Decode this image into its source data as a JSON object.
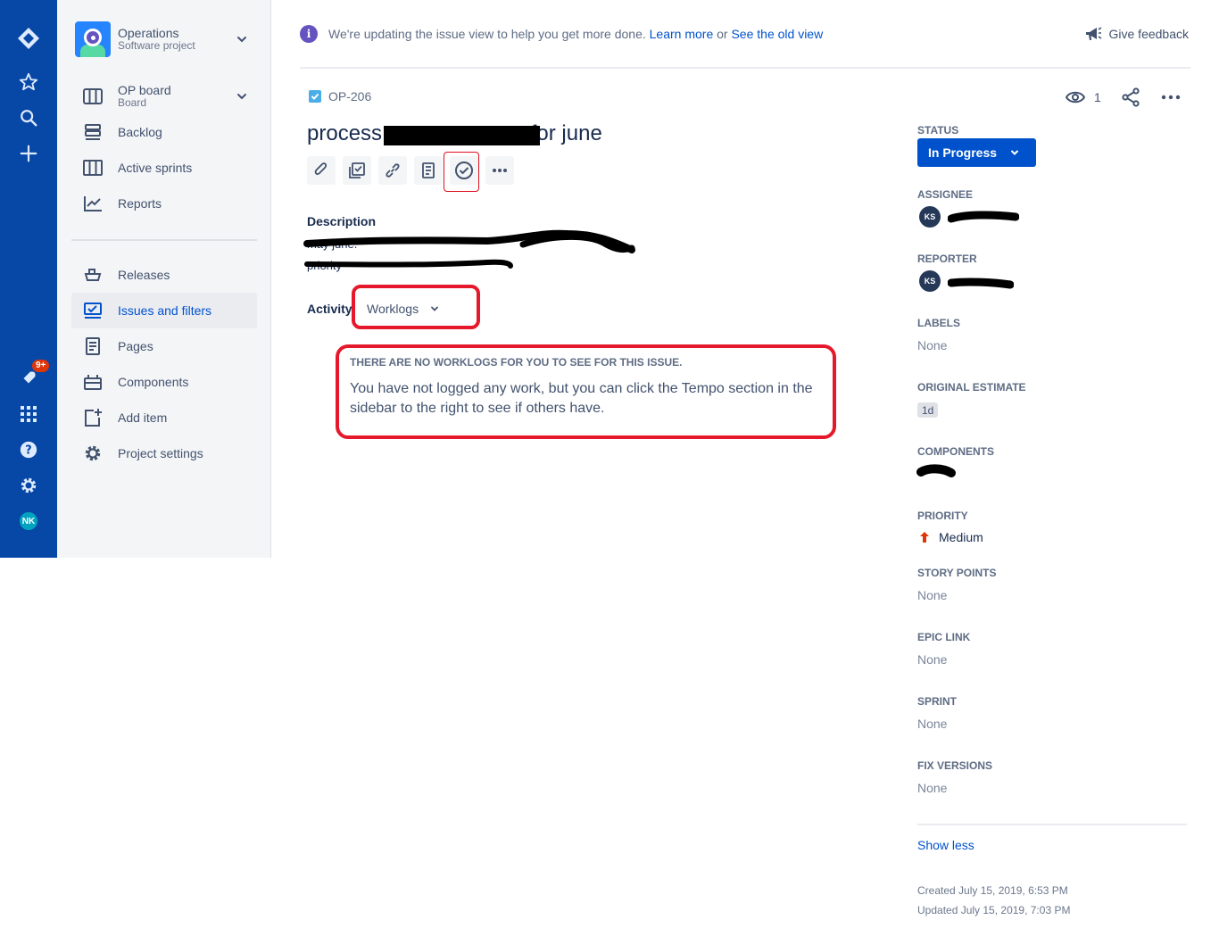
{
  "global_nav": {
    "notification_badge": "9+",
    "avatar_initials": "NK",
    "bg_color": "#0747a6"
  },
  "sidebar": {
    "project_name": "Operations",
    "project_type": "Software project",
    "board_name": "OP board",
    "board_type": "Board",
    "items": [
      {
        "label": "Backlog"
      },
      {
        "label": "Active sprints"
      },
      {
        "label": "Reports"
      },
      {
        "label": "Releases"
      },
      {
        "label": "Issues and filters"
      },
      {
        "label": "Pages"
      },
      {
        "label": "Components"
      },
      {
        "label": "Add item"
      },
      {
        "label": "Project settings"
      }
    ]
  },
  "banner": {
    "text": "We're updating the issue view to help you get more done.",
    "learn_more": "Learn more",
    "or": "or",
    "old_view": "See the old view",
    "feedback": "Give feedback"
  },
  "issue": {
    "key": "OP-206",
    "title": "process                         for june",
    "watchers": "1",
    "description_label": "Description",
    "desc_line1": "                                                                  may june.",
    "desc_line2": "                                 priority",
    "activity_label": "Activity",
    "activity_filter": "Worklogs",
    "worklog_title": "THERE ARE NO WORKLOGS FOR YOU TO SEE FOR THIS ISSUE.",
    "worklog_body": "You have not logged any work, but you can click the Tempo section in the sidebar to the right to see if others have."
  },
  "fields": {
    "status_label": "STATUS",
    "status_value": "In Progress",
    "assignee_label": "ASSIGNEE",
    "assignee_initials": "KS",
    "reporter_label": "REPORTER",
    "reporter_initials": "KS",
    "labels_label": "LABELS",
    "labels_value": "None",
    "estimate_label": "ORIGINAL ESTIMATE",
    "estimate_value": "1d",
    "components_label": "COMPONENTS",
    "priority_label": "PRIORITY",
    "priority_value": "Medium",
    "story_points_label": "STORY POINTS",
    "story_points_value": "None",
    "epic_link_label": "EPIC LINK",
    "epic_link_value": "None",
    "sprint_label": "SPRINT",
    "sprint_value": "None",
    "fix_versions_label": "FIX VERSIONS",
    "fix_versions_value": "None",
    "show_less": "Show less",
    "created": "Created July 15, 2019, 6:53 PM",
    "updated": "Updated July 15, 2019, 7:03 PM"
  },
  "colors": {
    "accent": "#0052cc",
    "annotation_red": "#e5192b",
    "priority_medium": "#de350b"
  },
  "icons": [
    "jira-logo-icon",
    "star-icon",
    "search-icon",
    "plus-icon",
    "rocket-icon",
    "app-switcher-icon",
    "help-icon",
    "settings-icon",
    "board-icon",
    "backlog-icon",
    "sprints-icon",
    "reports-icon",
    "releases-icon",
    "issues-icon",
    "pages-icon",
    "components-icon",
    "add-item-icon",
    "project-settings-icon",
    "info-icon",
    "megaphone-icon",
    "eye-icon",
    "share-icon",
    "more-icon",
    "attachment-icon",
    "subtask-icon",
    "link-icon",
    "confluence-page-icon",
    "tempo-icon",
    "chevron-down-icon",
    "priority-medium-icon"
  ]
}
